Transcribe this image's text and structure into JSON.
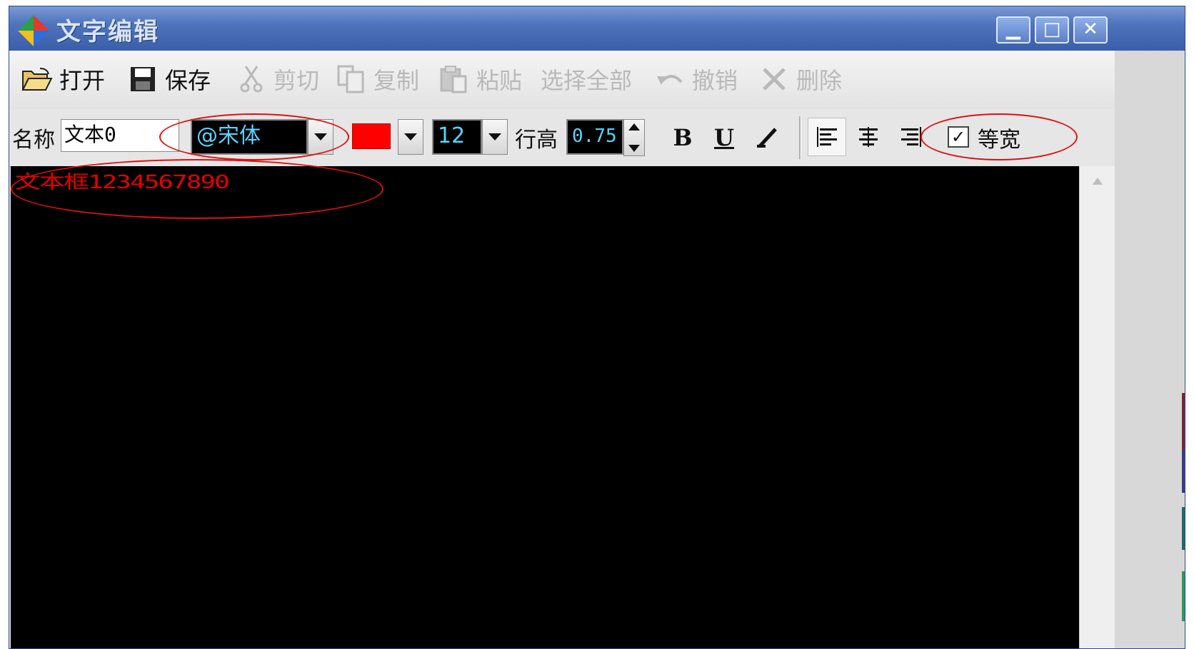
{
  "window": {
    "title": "文字编辑"
  },
  "toolbar": {
    "open": "打开",
    "save": "保存",
    "cut": "剪切",
    "copy": "复制",
    "paste": "粘贴",
    "select_all": "选择全部",
    "undo": "撤销",
    "delete": "删除"
  },
  "format_bar": {
    "name_label": "名称",
    "name_value": "文本0",
    "font": "@宋体",
    "color": "#ff0000",
    "font_size": "12",
    "line_height_label": "行高",
    "line_height_value": "0.75",
    "bold": "B",
    "underline": "U",
    "monospace_label": "等宽",
    "monospace_checked": true
  },
  "editor": {
    "text": "文本框1234567890",
    "text_color": "#ff0000",
    "background": "#000000"
  },
  "annotation_color": "#dd1111"
}
